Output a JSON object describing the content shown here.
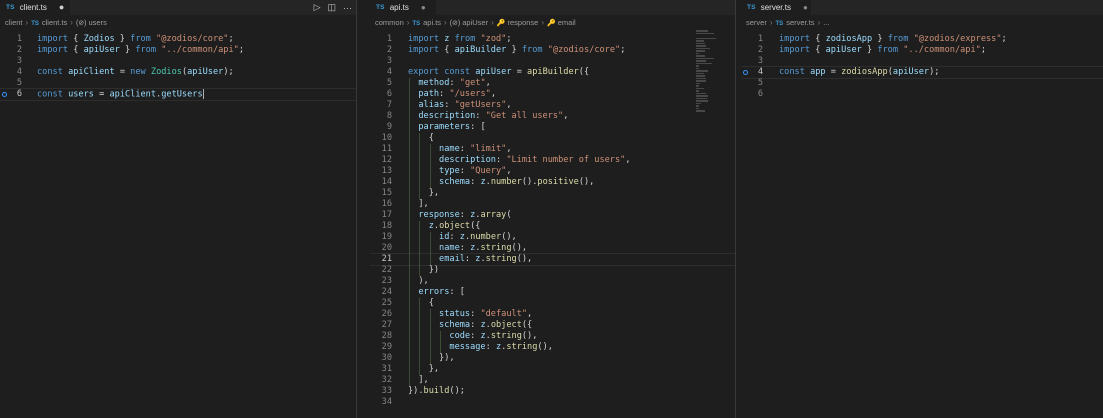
{
  "colors": {
    "keyword": "#569cd6",
    "string": "#ce9178",
    "variable": "#9cdcfe",
    "function": "#dcdcaa",
    "plain": "#d4d4d4",
    "number": "#b5cea8",
    "type": "#4ec9b0"
  },
  "left": {
    "tab": {
      "badge": "TS",
      "name": "client.ts",
      "dirty": "●"
    },
    "actions": {
      "run": "▷",
      "split": "◫",
      "more": "···"
    },
    "breadcrumb": [
      {
        "text": "client",
        "kind": "folder"
      },
      {
        "text": "client.ts",
        "kind": "file",
        "badge": "TS"
      },
      {
        "text": "users",
        "kind": "symbol",
        "icon": "(⊘)"
      }
    ],
    "lines": [
      {
        "n": "1",
        "tokens": [
          [
            "import",
            "keyword"
          ],
          [
            " { ",
            "plain"
          ],
          [
            "Zodios",
            "variable"
          ],
          [
            " } ",
            "plain"
          ],
          [
            "from",
            "keyword"
          ],
          [
            " ",
            "plain"
          ],
          [
            "\"@zodios/core\"",
            "string"
          ],
          [
            ";",
            "plain"
          ]
        ]
      },
      {
        "n": "2",
        "tokens": [
          [
            "import",
            "keyword"
          ],
          [
            " { ",
            "plain"
          ],
          [
            "apiUser",
            "variable"
          ],
          [
            " } ",
            "plain"
          ],
          [
            "from",
            "keyword"
          ],
          [
            " ",
            "plain"
          ],
          [
            "\"../common/api\"",
            "string"
          ],
          [
            ";",
            "plain"
          ]
        ]
      },
      {
        "n": "3",
        "tokens": []
      },
      {
        "n": "4",
        "tokens": [
          [
            "const",
            "keyword"
          ],
          [
            " ",
            "plain"
          ],
          [
            "apiClient",
            "variable"
          ],
          [
            " = ",
            "plain"
          ],
          [
            "new",
            "keyword"
          ],
          [
            " ",
            "plain"
          ],
          [
            "Zodios",
            "type"
          ],
          [
            "(",
            "plain"
          ],
          [
            "apiUser",
            "variable"
          ],
          [
            ");",
            "plain"
          ]
        ]
      },
      {
        "n": "5",
        "tokens": []
      },
      {
        "n": "6",
        "tokens": [
          [
            "const",
            "keyword"
          ],
          [
            " ",
            "plain"
          ],
          [
            "users",
            "variable"
          ],
          [
            " = ",
            "plain"
          ],
          [
            "apiClient",
            "variable"
          ],
          [
            ".",
            "plain"
          ],
          [
            "getUsers",
            "variable"
          ]
        ],
        "active": true,
        "caret": true,
        "bulb": true
      }
    ]
  },
  "middle": {
    "tab": {
      "badge": "TS",
      "name": "api.ts",
      "dirty": "●"
    },
    "breadcrumb": [
      {
        "text": "common",
        "kind": "folder"
      },
      {
        "text": "api.ts",
        "kind": "file",
        "badge": "TS"
      },
      {
        "text": "apiUser",
        "kind": "symbol",
        "icon": "(⊘)"
      },
      {
        "text": "response",
        "kind": "symbol",
        "icon": "🔑"
      },
      {
        "text": "email",
        "kind": "symbol",
        "icon": "🔑"
      }
    ],
    "lines": [
      {
        "n": "1",
        "tokens": [
          [
            "import",
            "keyword"
          ],
          [
            " ",
            "plain"
          ],
          [
            "z",
            "variable"
          ],
          [
            " ",
            "plain"
          ],
          [
            "from",
            "keyword"
          ],
          [
            " ",
            "plain"
          ],
          [
            "\"zod\"",
            "string"
          ],
          [
            ";",
            "plain"
          ]
        ]
      },
      {
        "n": "2",
        "tokens": [
          [
            "import",
            "keyword"
          ],
          [
            " { ",
            "plain"
          ],
          [
            "apiBuilder",
            "variable"
          ],
          [
            " } ",
            "plain"
          ],
          [
            "from",
            "keyword"
          ],
          [
            " ",
            "plain"
          ],
          [
            "\"@zodios/core\"",
            "string"
          ],
          [
            ";",
            "plain"
          ]
        ]
      },
      {
        "n": "3",
        "tokens": []
      },
      {
        "n": "4",
        "tokens": [
          [
            "export",
            "keyword"
          ],
          [
            " ",
            "plain"
          ],
          [
            "const",
            "keyword"
          ],
          [
            " ",
            "plain"
          ],
          [
            "apiUser",
            "variable"
          ],
          [
            " = ",
            "plain"
          ],
          [
            "apiBuilder",
            "function"
          ],
          [
            "({",
            "plain"
          ]
        ]
      },
      {
        "n": "5",
        "tokens": [
          [
            "  method",
            "variable"
          ],
          [
            ": ",
            "plain"
          ],
          [
            "\"get\"",
            "string"
          ],
          [
            ",",
            "plain"
          ]
        ]
      },
      {
        "n": "6",
        "tokens": [
          [
            "  path",
            "variable"
          ],
          [
            ": ",
            "plain"
          ],
          [
            "\"/users\"",
            "string"
          ],
          [
            ",",
            "plain"
          ]
        ]
      },
      {
        "n": "7",
        "tokens": [
          [
            "  alias",
            "variable"
          ],
          [
            ": ",
            "plain"
          ],
          [
            "\"getUsers\"",
            "string"
          ],
          [
            ",",
            "plain"
          ]
        ]
      },
      {
        "n": "8",
        "tokens": [
          [
            "  description",
            "variable"
          ],
          [
            ": ",
            "plain"
          ],
          [
            "\"Get all users\"",
            "string"
          ],
          [
            ",",
            "plain"
          ]
        ]
      },
      {
        "n": "9",
        "tokens": [
          [
            "  parameters",
            "variable"
          ],
          [
            ": [",
            "plain"
          ]
        ]
      },
      {
        "n": "10",
        "tokens": [
          [
            "    {",
            "plain"
          ]
        ]
      },
      {
        "n": "11",
        "tokens": [
          [
            "      name",
            "variable"
          ],
          [
            ": ",
            "plain"
          ],
          [
            "\"limit\"",
            "string"
          ],
          [
            ",",
            "plain"
          ]
        ]
      },
      {
        "n": "12",
        "tokens": [
          [
            "      description",
            "variable"
          ],
          [
            ": ",
            "plain"
          ],
          [
            "\"Limit number of users\"",
            "string"
          ],
          [
            ",",
            "plain"
          ]
        ]
      },
      {
        "n": "13",
        "tokens": [
          [
            "      type",
            "variable"
          ],
          [
            ": ",
            "plain"
          ],
          [
            "\"Query\"",
            "string"
          ],
          [
            ",",
            "plain"
          ]
        ]
      },
      {
        "n": "14",
        "tokens": [
          [
            "      schema",
            "variable"
          ],
          [
            ": ",
            "plain"
          ],
          [
            "z",
            "variable"
          ],
          [
            ".",
            "plain"
          ],
          [
            "number",
            "function"
          ],
          [
            "().",
            "plain"
          ],
          [
            "positive",
            "function"
          ],
          [
            "(),",
            "plain"
          ]
        ]
      },
      {
        "n": "15",
        "tokens": [
          [
            "    },",
            "plain"
          ]
        ]
      },
      {
        "n": "16",
        "tokens": [
          [
            "  ],",
            "plain"
          ]
        ]
      },
      {
        "n": "17",
        "tokens": [
          [
            "  response",
            "variable"
          ],
          [
            ": ",
            "plain"
          ],
          [
            "z",
            "variable"
          ],
          [
            ".",
            "plain"
          ],
          [
            "array",
            "function"
          ],
          [
            "(",
            "plain"
          ]
        ]
      },
      {
        "n": "18",
        "tokens": [
          [
            "    z",
            "variable"
          ],
          [
            ".",
            "plain"
          ],
          [
            "object",
            "function"
          ],
          [
            "({",
            "plain"
          ]
        ]
      },
      {
        "n": "19",
        "tokens": [
          [
            "      id",
            "variable"
          ],
          [
            ": ",
            "plain"
          ],
          [
            "z",
            "variable"
          ],
          [
            ".",
            "plain"
          ],
          [
            "number",
            "function"
          ],
          [
            "(),",
            "plain"
          ]
        ]
      },
      {
        "n": "20",
        "tokens": [
          [
            "      name",
            "variable"
          ],
          [
            ": ",
            "plain"
          ],
          [
            "z",
            "variable"
          ],
          [
            ".",
            "plain"
          ],
          [
            "string",
            "function"
          ],
          [
            "(),",
            "plain"
          ]
        ]
      },
      {
        "n": "21",
        "tokens": [
          [
            "      email",
            "variable"
          ],
          [
            ": ",
            "plain"
          ],
          [
            "z",
            "variable"
          ],
          [
            ".",
            "plain"
          ],
          [
            "string",
            "function"
          ],
          [
            "(),",
            "plain"
          ]
        ],
        "active": true
      },
      {
        "n": "22",
        "tokens": [
          [
            "    })",
            "plain"
          ]
        ]
      },
      {
        "n": "23",
        "tokens": [
          [
            "  ),",
            "plain"
          ]
        ]
      },
      {
        "n": "24",
        "tokens": [
          [
            "  errors",
            "variable"
          ],
          [
            ": [",
            "plain"
          ]
        ]
      },
      {
        "n": "25",
        "tokens": [
          [
            "    {",
            "plain"
          ]
        ]
      },
      {
        "n": "26",
        "tokens": [
          [
            "      status",
            "variable"
          ],
          [
            ": ",
            "plain"
          ],
          [
            "\"default\"",
            "string"
          ],
          [
            ",",
            "plain"
          ]
        ]
      },
      {
        "n": "27",
        "tokens": [
          [
            "      schema",
            "variable"
          ],
          [
            ": ",
            "plain"
          ],
          [
            "z",
            "variable"
          ],
          [
            ".",
            "plain"
          ],
          [
            "object",
            "function"
          ],
          [
            "({",
            "plain"
          ]
        ]
      },
      {
        "n": "28",
        "tokens": [
          [
            "        code",
            "variable"
          ],
          [
            ": ",
            "plain"
          ],
          [
            "z",
            "variable"
          ],
          [
            ".",
            "plain"
          ],
          [
            "string",
            "function"
          ],
          [
            "(),",
            "plain"
          ]
        ]
      },
      {
        "n": "29",
        "tokens": [
          [
            "        message",
            "variable"
          ],
          [
            ": ",
            "plain"
          ],
          [
            "z",
            "variable"
          ],
          [
            ".",
            "plain"
          ],
          [
            "string",
            "function"
          ],
          [
            "(),",
            "plain"
          ]
        ]
      },
      {
        "n": "30",
        "tokens": [
          [
            "      }),",
            "plain"
          ]
        ]
      },
      {
        "n": "31",
        "tokens": [
          [
            "    },",
            "plain"
          ]
        ]
      },
      {
        "n": "32",
        "tokens": [
          [
            "  ],",
            "plain"
          ]
        ]
      },
      {
        "n": "33",
        "tokens": [
          [
            "}).",
            "plain"
          ],
          [
            "build",
            "function"
          ],
          [
            "();",
            "plain"
          ]
        ]
      },
      {
        "n": "34",
        "tokens": []
      }
    ]
  },
  "right": {
    "tab": {
      "badge": "TS",
      "name": "server.ts",
      "dirty": "●"
    },
    "breadcrumb": [
      {
        "text": "server",
        "kind": "folder"
      },
      {
        "text": "server.ts",
        "kind": "file",
        "badge": "TS"
      },
      {
        "text": "...",
        "kind": "plain"
      }
    ],
    "lines": [
      {
        "n": "1",
        "tokens": [
          [
            "import",
            "keyword"
          ],
          [
            " { ",
            "plain"
          ],
          [
            "zodiosApp",
            "variable"
          ],
          [
            " } ",
            "plain"
          ],
          [
            "from",
            "keyword"
          ],
          [
            " ",
            "plain"
          ],
          [
            "\"@zodios/express\"",
            "string"
          ],
          [
            ";",
            "plain"
          ]
        ]
      },
      {
        "n": "2",
        "tokens": [
          [
            "import",
            "keyword"
          ],
          [
            " { ",
            "plain"
          ],
          [
            "apiUser",
            "variable"
          ],
          [
            " } ",
            "plain"
          ],
          [
            "from",
            "keyword"
          ],
          [
            " ",
            "plain"
          ],
          [
            "\"../common/api\"",
            "string"
          ],
          [
            ";",
            "plain"
          ]
        ]
      },
      {
        "n": "3",
        "tokens": []
      },
      {
        "n": "4",
        "tokens": [
          [
            "const",
            "keyword"
          ],
          [
            " ",
            "plain"
          ],
          [
            "app",
            "variable"
          ],
          [
            " = ",
            "plain"
          ],
          [
            "zodiosApp",
            "function"
          ],
          [
            "(",
            "plain"
          ],
          [
            "apiUser",
            "variable"
          ],
          [
            ");",
            "plain"
          ]
        ],
        "active": true,
        "bulb": true
      },
      {
        "n": "5",
        "tokens": []
      },
      {
        "n": "6",
        "tokens": []
      }
    ]
  }
}
